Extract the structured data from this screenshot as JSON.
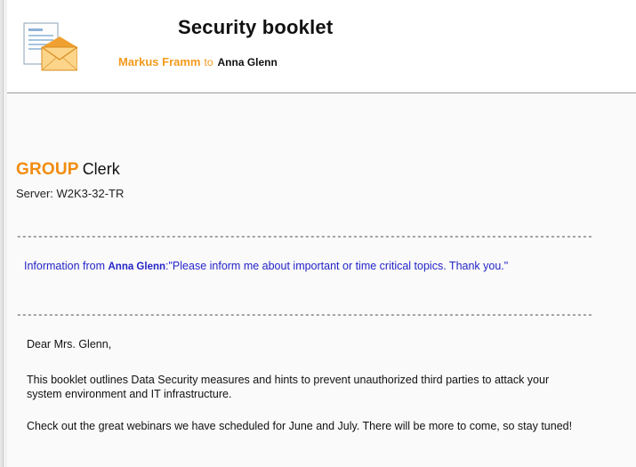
{
  "email": {
    "subject": "Security booklet",
    "sender": "Markus Framm",
    "to_word": "to",
    "recipient": "Anna Glenn"
  },
  "icons": {
    "mail": "email-document-icon"
  },
  "brand": {
    "group": "GROUP",
    "clerk": "Clerk"
  },
  "server": "Server: W2K3-32-TR",
  "separator": "-------------------------------------------------------------------------------------------------------------------------------------------",
  "info": {
    "prefix": "Information from ",
    "name": "Anna Glenn",
    "message": ":\"Please inform me about important or time critical topics. Thank you.\""
  },
  "body": {
    "greeting": "Dear Mrs. Glenn,",
    "paragraph1": "This booklet outlines Data Security measures and hints to prevent unauthorized third parties to attack your system environment and IT infrastructure.",
    "paragraph2": "Check out the great webinars we have scheduled for June and July. There will be more to come, so stay tuned!"
  },
  "colors": {
    "accent_orange": "#f39a1c",
    "info_blue": "#2424c8"
  }
}
